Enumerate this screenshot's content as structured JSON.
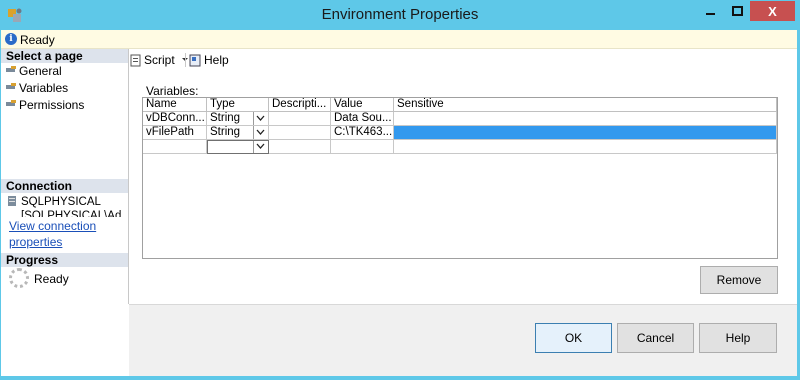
{
  "window": {
    "title": "Environment Properties",
    "close_glyph": "X"
  },
  "status": {
    "text": "Ready"
  },
  "left_pane": {
    "select_page_header": "Select a page",
    "pages": [
      {
        "label": "General",
        "icon": "wrench-icon"
      },
      {
        "label": "Variables",
        "icon": "wrench-icon"
      },
      {
        "label": "Permissions",
        "icon": "wrench-icon"
      }
    ],
    "connection_header": "Connection",
    "connection_server": "SQLPHYSICAL",
    "connection_user": "[SQLPHYSICAL\\Ad",
    "view_connection_properties": "View connection properties",
    "progress_header": "Progress",
    "progress_status": "Ready"
  },
  "toolbar": {
    "script_label": "Script",
    "help_label": "Help"
  },
  "variables": {
    "label": "Variables:",
    "columns": [
      "Name",
      "Type",
      "Descripti...",
      "Value",
      "Sensitive"
    ],
    "rows": [
      {
        "name": "vDBConn...",
        "type": "String",
        "description": "",
        "value": "Data Sou...",
        "sensitive": ""
      },
      {
        "name": "vFilePath",
        "type": "String",
        "description": "",
        "value": "C:\\TK463...",
        "sensitive": ""
      }
    ],
    "remove_label": "Remove"
  },
  "buttons": {
    "ok": "OK",
    "cancel": "Cancel",
    "help": "Help"
  },
  "colors": {
    "titlebar": "#5ec8e8",
    "selection": "#3399ee",
    "close": "#c75050"
  }
}
